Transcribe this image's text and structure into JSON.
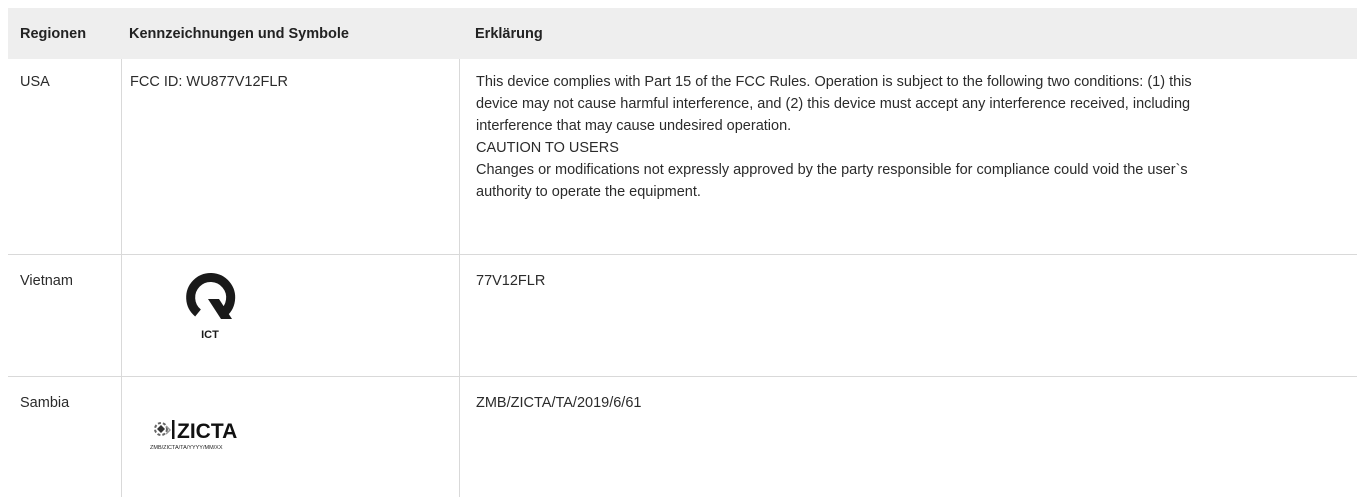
{
  "table": {
    "headers": [
      "Regionen",
      "Kennzeichnungen und Symbole",
      "Erklärung"
    ],
    "rows": [
      {
        "region": "USA",
        "marking": "FCC ID: WU877V12FLR",
        "explanation_lines": [
          "This device complies with Part 15 of the FCC Rules. Operation is subject to the following two conditions: (1) this",
          "device may not cause harmful interference, and (2) this device must accept any interference received, including",
          "interference that may cause undesired operation.",
          "CAUTION TO USERS",
          "Changes or modifications not expressly approved by the party responsible for compliance could void the user`s",
          "authority to operate the equipment."
        ]
      },
      {
        "region": "Vietnam",
        "marking_logo": "ict-logo",
        "marking_logo_text": "ICT",
        "explanation": "77V12FLR"
      },
      {
        "region": "Sambia",
        "marking_logo": "zicta-logo",
        "marking_logo_text": "ZICTA",
        "marking_logo_subtext": "ZMB/ZICTA/TA/YYYY/MM/XX",
        "explanation": "ZMB/ZICTA/TA/2019/6/61"
      }
    ]
  }
}
